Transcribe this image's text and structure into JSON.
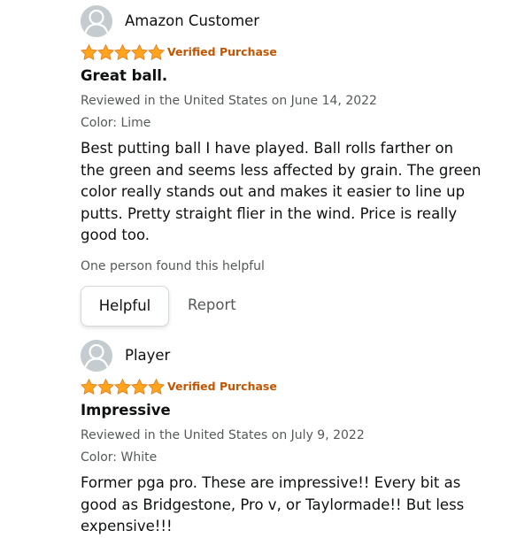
{
  "colors": {
    "star": "#ffa41c",
    "verified": "#c45500",
    "text": "#0f1111",
    "muted": "#565959",
    "avatar": "#c4cccf"
  },
  "reviews": [
    {
      "author": "Amazon Customer",
      "avatar_icon": "user-avatar-icon",
      "rating": 5,
      "rating_max": 5,
      "verified_label": "Verified Purchase",
      "title": "Great ball.",
      "date_text": "Reviewed in the United States on June 14, 2022",
      "variant_text": "Color: Lime",
      "body_lines": [
        "Best putting ball I have played. Ball rolls farther on",
        "the green and seems less affected by grain. The green",
        "color really stands out and makes it easier to line up",
        "putts. Pretty straight flier in the wind. Price is really",
        "good too."
      ],
      "helpful_count_text": "One person found this helpful",
      "helpful_button": "Helpful",
      "report_link": "Report"
    },
    {
      "author": "Player",
      "avatar_icon": "user-avatar-icon",
      "rating": 5,
      "rating_max": 5,
      "verified_label": "Verified Purchase",
      "title": "Impressive",
      "date_text": "Reviewed in the United States on July 9, 2022",
      "variant_text": "Color: White",
      "body_lines": [
        "Former pga pro. These are impressive!! Every bit as",
        "good as Bridgestone, Pro v, or Taylormade!! But less",
        "expensive!!!"
      ]
    }
  ]
}
